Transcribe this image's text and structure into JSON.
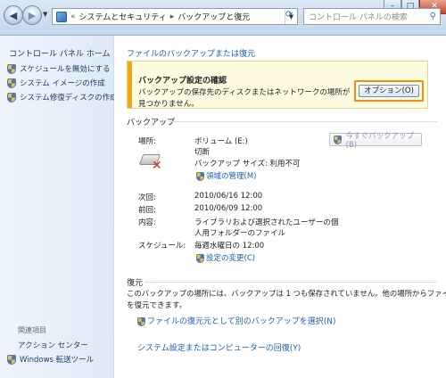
{
  "titlebar": {
    "breadcrumb_prefix": "«",
    "crumb1": "システムとセキュリティ",
    "crumb2": "バックアップと復元",
    "search_placeholder": "コントロール パネルの検索"
  },
  "sidebar": {
    "home": "コントロール パネル ホーム",
    "links": [
      "スケジュールを無効にする",
      "システム イメージの作成",
      "システム修復ディスクの作成"
    ],
    "related_header": "関連項目",
    "related": [
      "アクション センター",
      "Windows 転送ツール"
    ]
  },
  "main": {
    "top_link": "ファイルのバックアップまたは復元",
    "warning": {
      "title": "バックアップ設定の確認",
      "text": "バックアップの保存先のディスクまたはネットワークの場所が見つかりません。",
      "button": "オプション(O)"
    },
    "backup": {
      "header": "バックアップ",
      "location_label": "場所:",
      "location_value": "ボリューム (E:)",
      "status": "切断",
      "size": "バックアップ サイズ: 利用不可",
      "manage_link": "領域の管理(M)",
      "backup_now": "今すぐバックアップ(B)",
      "next_label": "次回:",
      "next_value": "2010/06/16 12:00",
      "prev_label": "前回:",
      "prev_value": "2010/06/09 12:00",
      "contents_label": "内容:",
      "contents_value_1": "ライブラリおよび選択されたユーザーの個",
      "contents_value_2": "人用フォルダーのファイル",
      "schedule_label": "スケジュール:",
      "schedule_value": "毎週水曜日の 12:00",
      "change_link": "設定の変更(C)"
    },
    "restore": {
      "header": "復元",
      "text_1": "このバックアップの場所には、バックアップは 1 つも保存されていません。他の場所からファイル",
      "text_2": "を復元できます。",
      "select_link": "ファイルの復元元として別のバックアップを選択(N)",
      "recover_link": "システム設定またはコンピューターの回復(Y)"
    }
  },
  "colors": {
    "link": "#1a5fb4",
    "warning_accent": "#f1a815",
    "highlight_frame": "#f08c1a"
  }
}
